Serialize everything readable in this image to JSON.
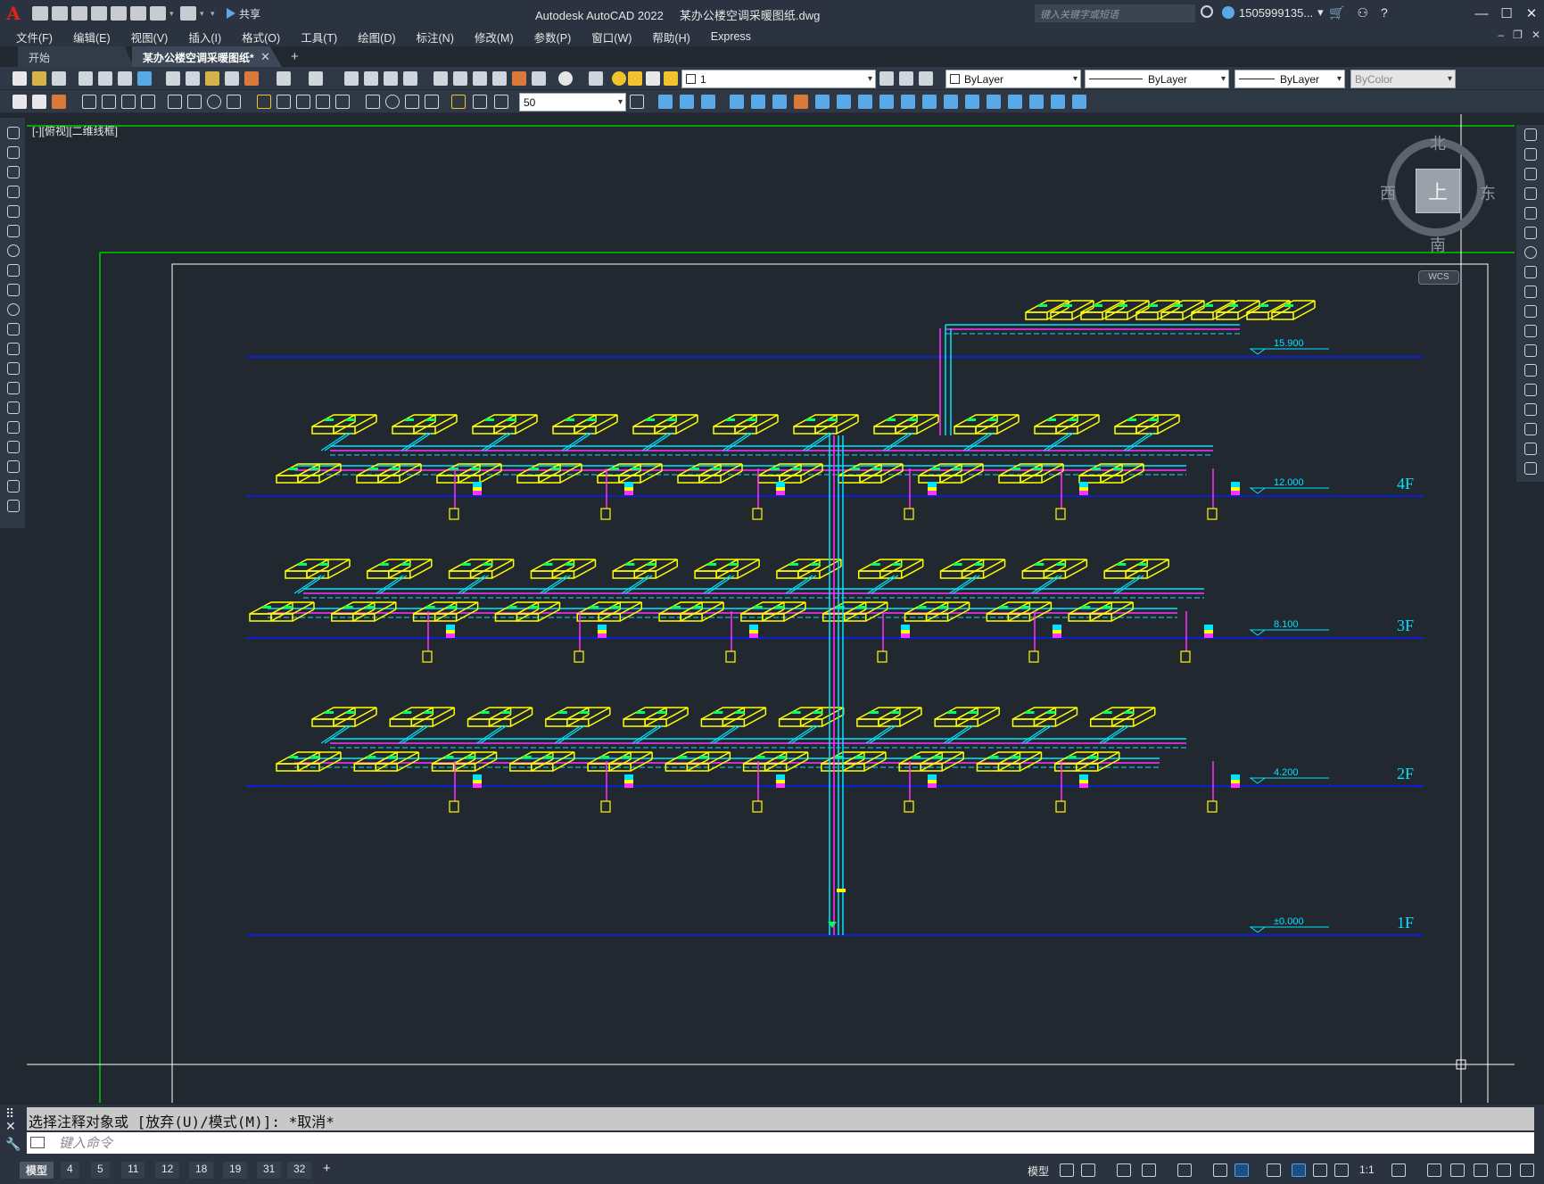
{
  "titlebar": {
    "app_name": "Autodesk AutoCAD 2022",
    "file_name": "某办公楼空调采暖图纸.dwg",
    "share_label": "共享",
    "search_placeholder": "键入关键字或短语",
    "user_name": "1505999135..."
  },
  "menu": [
    "文件(F)",
    "编辑(E)",
    "视图(V)",
    "插入(I)",
    "格式(O)",
    "工具(T)",
    "绘图(D)",
    "标注(N)",
    "修改(M)",
    "参数(P)",
    "窗口(W)",
    "帮助(H)",
    "Express"
  ],
  "tabs": {
    "start": "开始",
    "active": "某办公楼空调采暖图纸*"
  },
  "properties": {
    "layer": "1",
    "color": "ByLayer",
    "linetype": "ByLayer",
    "lineweight": "ByLayer",
    "plotstyle": "ByColor",
    "dim_scale": "50"
  },
  "viewport": {
    "label": "[-][俯视][二维线框]",
    "cube_top": "上",
    "north": "北",
    "south": "南",
    "east": "东",
    "west": "西",
    "wcs": "WCS"
  },
  "drawing": {
    "levels": [
      {
        "elevation": "15.900",
        "floor": ""
      },
      {
        "elevation": "12.000",
        "floor": "4F"
      },
      {
        "elevation": "8.100",
        "floor": "3F"
      },
      {
        "elevation": "4.200",
        "floor": "2F"
      },
      {
        "elevation": "±0.000",
        "floor": "1F"
      }
    ],
    "colors": {
      "level_line": "#0a1fd6",
      "pipe_supply": "#00e5ff",
      "pipe_return": "#ff33ff",
      "unit": "#ffff00",
      "frame": "#ffffff",
      "border": "#00c800"
    }
  },
  "command": {
    "history": "选择注释对象或 [放弃(U)/模式(M)]: *取消*",
    "placeholder": "键入命令"
  },
  "status": {
    "layouts": [
      "模型",
      "4",
      "5",
      "11",
      "12",
      "18",
      "19",
      "31",
      "32"
    ],
    "model_label": "模型",
    "scale": "1:1"
  }
}
